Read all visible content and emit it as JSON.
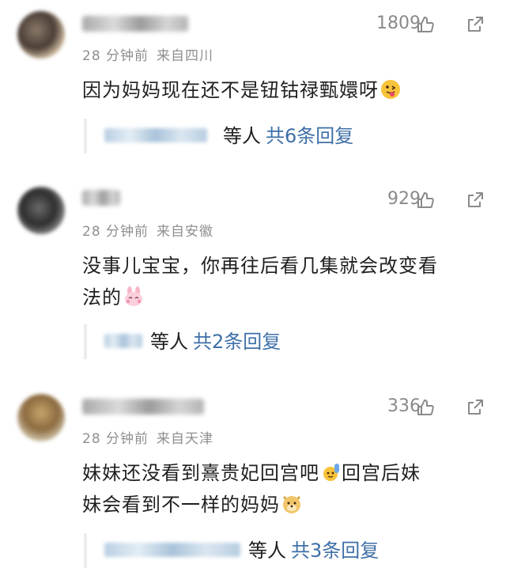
{
  "comments": [
    {
      "time": "28 分钟前",
      "location": "来自四川",
      "likes": "1809",
      "text": "因为妈妈现在还不是钮钴禄甄嬛呀",
      "emoji": "tongue-face-emoji",
      "reply_suffix": "等人",
      "reply_count": "共6条回复"
    },
    {
      "time": "28 分钟前",
      "location": "来自安徽",
      "likes": "929",
      "text_line1": "没事儿宝宝，你再往后看几集就会改变看",
      "text_line2": "法的",
      "emoji": "pink-bunny-emoji",
      "reply_suffix": "等人",
      "reply_count": "共2条回复"
    },
    {
      "time": "28 分钟前",
      "location": "来自天津",
      "likes": "336",
      "text_line1a": "妹妹还没看到熹贵妃回宫吧",
      "text_line1b": "回宫后妹",
      "text_line2": "妹会看到不一样的妈妈",
      "emoji_mid": "raising-hand-emoji",
      "emoji_end": "doge-emoji",
      "reply_suffix": "等人",
      "reply_count": "共3条回复"
    }
  ],
  "colors": {
    "link": "#3e6fa7",
    "meta": "#8f8f8f",
    "text": "#1f1f1f",
    "icon": "#8a8a8a"
  }
}
